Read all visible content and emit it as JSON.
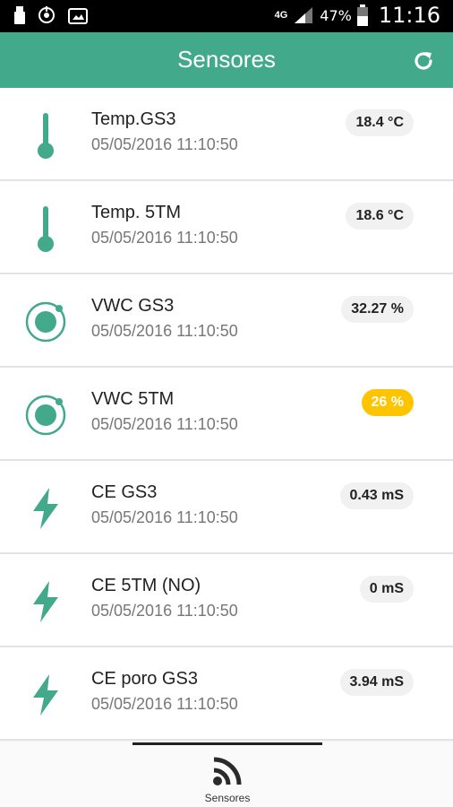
{
  "status_bar": {
    "network": "4G",
    "battery": "47%",
    "time": "11:16"
  },
  "header": {
    "title": "Sensores"
  },
  "sensors": [
    {
      "name": "Temp.GS3",
      "timestamp": "05/05/2016 11:10:50",
      "value": "18.4 °C",
      "icon": "thermometer-icon"
    },
    {
      "name": "Temp. 5TM",
      "timestamp": "05/05/2016 11:10:50",
      "value": "18.6 °C",
      "icon": "thermometer-icon"
    },
    {
      "name": "VWC GS3",
      "timestamp": "05/05/2016 11:10:50",
      "value": "32.27 %",
      "icon": "water-drop-ring-icon"
    },
    {
      "name": "VWC 5TM",
      "timestamp": "05/05/2016 11:10:50",
      "value": "26 %",
      "icon": "water-drop-ring-icon",
      "highlight_color": "#ffc400"
    },
    {
      "name": "CE GS3",
      "timestamp": "05/05/2016 11:10:50",
      "value": "0.43 mS",
      "icon": "lightning-icon"
    },
    {
      "name": "CE 5TM (NO)",
      "timestamp": "05/05/2016 11:10:50",
      "value": "0 mS",
      "icon": "lightning-icon"
    },
    {
      "name": "CE poro GS3",
      "timestamp": "05/05/2016 11:10:50",
      "value": "3.94 mS",
      "icon": "lightning-icon"
    }
  ],
  "bottom_nav": {
    "tab_label": "Sensores",
    "tab_icon": "rss-icon"
  },
  "colors": {
    "accent": "#43a98b",
    "warning": "#ffc400"
  }
}
